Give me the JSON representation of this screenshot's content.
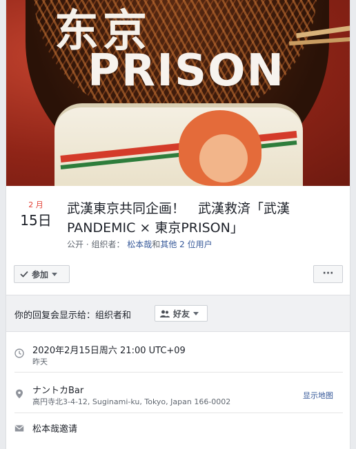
{
  "cover": {
    "brand_top": "东京",
    "brand": "PRISON"
  },
  "event": {
    "month": "2 月",
    "day": "15日",
    "title": "武漢東京共同企画！　武漢救済「武漢PANDEMIC × 東京PRISON」",
    "privacy": "公开 · 组织者：",
    "organizer": "松本哉",
    "organizer_suffix": "和",
    "others": "其他 2 位用户"
  },
  "actions": {
    "join_label": "参加",
    "more_label": "···"
  },
  "visibility": {
    "label": "你的回复会显示给：组织者和",
    "audience_label": "好友"
  },
  "details": {
    "datetime": "2020年2月15日周六 21:00 UTC+09",
    "relative": "昨天",
    "place_name": "ナントカBar",
    "address": "高円寺北3-4-12, Suginami-ku, Tokyo, Japan 166-0002",
    "map_link": "显示地图",
    "invite": "松本哉邀请"
  },
  "icons": [
    "check-icon",
    "caret-down-icon",
    "friends-icon",
    "clock-icon",
    "location-pin-icon",
    "mail-icon"
  ]
}
